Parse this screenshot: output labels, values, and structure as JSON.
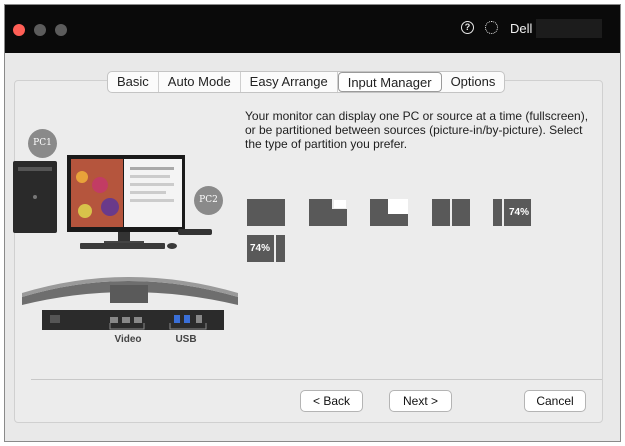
{
  "titlebar": {
    "user_name": "Dell",
    "help_icon": "help-circle-icon",
    "settings_icon": "gear-icon"
  },
  "tabs": [
    {
      "label": "Basic"
    },
    {
      "label": "Auto Mode"
    },
    {
      "label": "Easy Arrange"
    },
    {
      "label": "Input Manager",
      "active": true
    },
    {
      "label": "Options"
    }
  ],
  "description": "Your monitor can display one PC or source at a time (fullscreen), or be partitioned between sources (picture-in/by-picture).  Select the type of partition you prefer.",
  "illustration": {
    "pc1_label": "PC1",
    "pc2_label": "PC2",
    "port_labels": {
      "video": "Video",
      "usb": "USB"
    }
  },
  "partition_options": [
    {
      "id": "fullscreen"
    },
    {
      "id": "pip-top-right"
    },
    {
      "id": "pip-top-left"
    },
    {
      "id": "pbp-split"
    },
    {
      "id": "pbp-74-right",
      "label": "74%"
    },
    {
      "id": "pbp-74-left",
      "label": "74%"
    }
  ],
  "buttons": {
    "back": "< Back",
    "next": "Next >",
    "cancel": "Cancel"
  },
  "colors": {
    "titlebar": "#0a0a0a",
    "close": "#ff5f56",
    "partition_fill": "#595959"
  }
}
